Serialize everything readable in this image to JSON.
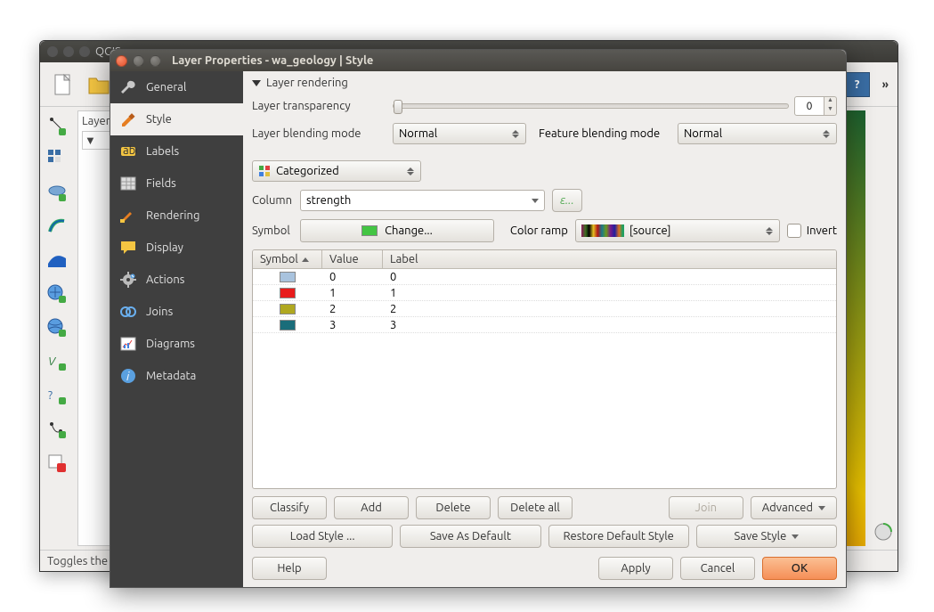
{
  "bg": {
    "title": "QGIS",
    "layers_label": "Layer",
    "status": "Toggles the edit"
  },
  "dialog": {
    "title": "Layer Properties - wa_geology | Style",
    "sidebar": {
      "items": [
        {
          "label": "General"
        },
        {
          "label": "Style"
        },
        {
          "label": "Labels"
        },
        {
          "label": "Fields"
        },
        {
          "label": "Rendering"
        },
        {
          "label": "Display"
        },
        {
          "label": "Actions"
        },
        {
          "label": "Joins"
        },
        {
          "label": "Diagrams"
        },
        {
          "label": "Metadata"
        }
      ]
    },
    "rendering": {
      "section_title": "Layer rendering",
      "transparency_label": "Layer transparency",
      "transparency_value": "0",
      "layer_blend_label": "Layer blending mode",
      "layer_blend_value": "Normal",
      "feature_blend_label": "Feature blending mode",
      "feature_blend_value": "Normal"
    },
    "renderer": {
      "type": "Categorized",
      "column_label": "Column",
      "column_value": "strength",
      "expr_btn": "ε...",
      "symbol_label": "Symbol",
      "change_label": "Change...",
      "ramp_label": "Color ramp",
      "ramp_value": "[source]",
      "invert_label": "Invert"
    },
    "table": {
      "headers": {
        "symbol": "Symbol",
        "value": "Value",
        "label": "Label"
      },
      "rows": [
        {
          "color": "#a9c3de",
          "value": "0",
          "label": "0"
        },
        {
          "color": "#e81c1c",
          "value": "1",
          "label": "1"
        },
        {
          "color": "#b0a820",
          "value": "2",
          "label": "2"
        },
        {
          "color": "#1a6d7a",
          "value": "3",
          "label": "3"
        }
      ]
    },
    "buttons": {
      "classify": "Classify",
      "add": "Add",
      "delete": "Delete",
      "delete_all": "Delete all",
      "join": "Join",
      "advanced": "Advanced",
      "load_style": "Load Style ...",
      "save_default": "Save As Default",
      "restore_default": "Restore Default Style",
      "save_style": "Save Style",
      "help": "Help",
      "apply": "Apply",
      "cancel": "Cancel",
      "ok": "OK"
    }
  }
}
